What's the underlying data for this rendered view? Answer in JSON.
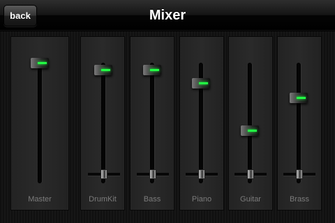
{
  "navbar": {
    "title": "Mixer",
    "back_label": "back"
  },
  "channels": [
    {
      "name": "Master",
      "level": 1.0,
      "has_pan": false
    },
    {
      "name": "DrumKit",
      "level": 0.94,
      "pan": 0.5,
      "has_pan": true
    },
    {
      "name": "Bass",
      "level": 0.94,
      "pan": 0.5,
      "has_pan": true
    },
    {
      "name": "Piano",
      "level": 0.83,
      "pan": 0.5,
      "has_pan": true
    },
    {
      "name": "Guitar",
      "level": 0.44,
      "pan": 0.5,
      "has_pan": true
    },
    {
      "name": "Brass",
      "level": 0.71,
      "pan": 0.5,
      "has_pan": true
    }
  ],
  "colors": {
    "led": "#22ff44",
    "label": "#7b7b7b"
  }
}
